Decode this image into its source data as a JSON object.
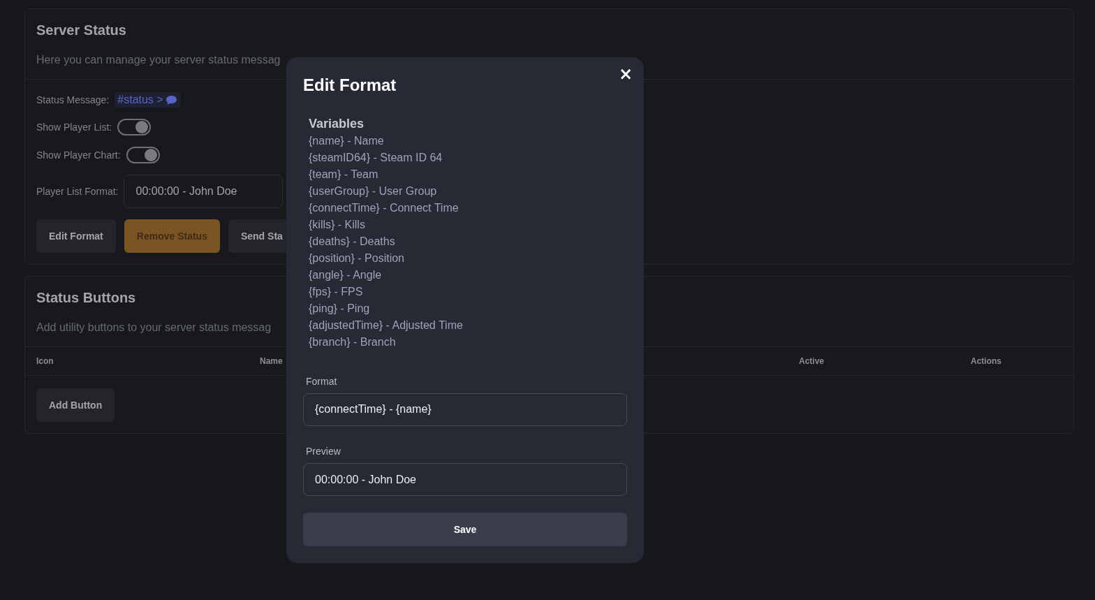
{
  "server_status": {
    "title": "Server Status",
    "description": "Here you can manage your server status messag",
    "status_message": {
      "label": "Status Message:",
      "channel": "#status >"
    },
    "toggles": [
      {
        "label": "Show Player List:",
        "on": true
      },
      {
        "label": "Show Player Chart:",
        "on": true
      }
    ],
    "player_list_format": {
      "label": "Player List Format:",
      "value": "00:00:00 - John Doe"
    },
    "buttons": [
      {
        "label": "Edit Format",
        "kind": "neutral"
      },
      {
        "label": "Remove Status",
        "kind": "warning"
      },
      {
        "label": "Send Sta",
        "kind": "neutral"
      }
    ]
  },
  "status_buttons": {
    "title": "Status Buttons",
    "description": "Add utility buttons to your server status messag",
    "table": {
      "columns": [
        "Icon",
        "Name",
        "Active",
        "Actions"
      ]
    },
    "add_button": "Add Button"
  },
  "modal": {
    "title": "Edit Format",
    "close": "×",
    "variables_title": "Variables",
    "variables": [
      "{name} - Name",
      "{steamID64} - Steam ID 64",
      "{team} - Team",
      "{userGroup} - User Group",
      "{connectTime} - Connect Time",
      "{kills} - Kills",
      "{deaths} - Deaths",
      "{position} - Position",
      "{angle} - Angle",
      "{fps} - FPS",
      "{ping} - Ping",
      "{adjustedTime} - Adjusted Time",
      "{branch} - Branch"
    ],
    "format_label": "Format",
    "format_value": "{connectTime} - {name}",
    "preview_label": "Preview",
    "preview_value": "00:00:00 - John Doe",
    "save": "Save"
  }
}
